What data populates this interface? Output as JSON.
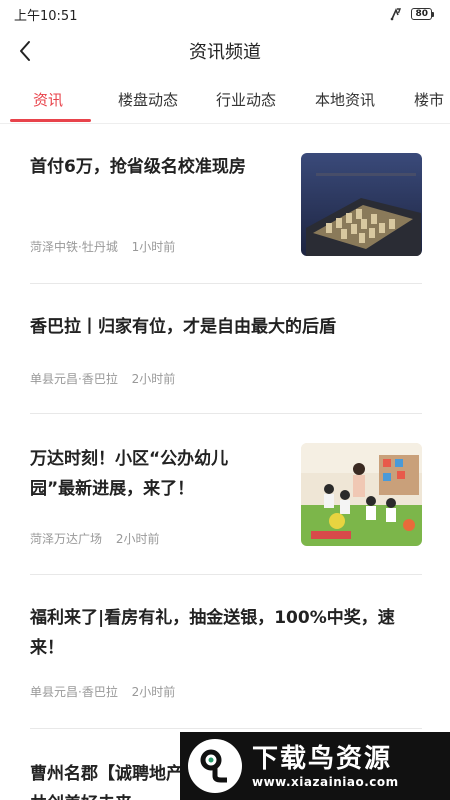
{
  "status_bar": {
    "time": "上午10:51",
    "battery": "80"
  },
  "nav": {
    "title": "资讯频道"
  },
  "tabs": [
    {
      "label": "资讯",
      "active": true
    },
    {
      "label": "楼盘动态",
      "active": false
    },
    {
      "label": "行业动态",
      "active": false
    },
    {
      "label": "本地资讯",
      "active": false
    },
    {
      "label": "楼市",
      "active": false
    }
  ],
  "news": [
    {
      "title_lines": [
        "首付6万，抢省级名校准现房"
      ],
      "source": "菏泽中铁·牡丹城",
      "time": "1小时前",
      "thumb": "aerial-residential-complex-photo"
    },
    {
      "title_lines": [
        "香巴拉丨归家有位，才是自由最大的后盾"
      ],
      "source": "单县元昌·香巴拉",
      "time": "2小时前",
      "thumb": null
    },
    {
      "title_lines": [
        "万达时刻！小区“公办幼儿",
        "园”最新进展，来了！"
      ],
      "source": "菏泽万达广场",
      "time": "2小时前",
      "thumb": "kindergarten-classroom-photo"
    },
    {
      "title_lines": [
        "福利来了|看房有礼，抽金送银，100%中奖，速",
        "来！"
      ],
      "source": "单县元昌·香巴拉",
      "time": "2小时前",
      "thumb": null
    },
    {
      "title_lines": [
        "曹州名郡【诚聘地产",
        "共创美好未来"
      ],
      "source": "",
      "time": "",
      "thumb": null
    }
  ],
  "watermark": {
    "title": "下载鸟资源",
    "url": "www.xiazainiao.com"
  },
  "colors": {
    "accent": "#e8434b",
    "meta": "#999999",
    "divider": "#e8e8e8"
  }
}
